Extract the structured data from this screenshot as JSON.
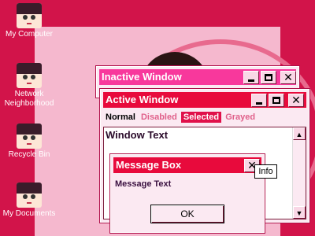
{
  "desktop_icons": [
    {
      "label": "My Computer"
    },
    {
      "label": "Network Neighborhood"
    },
    {
      "label": "Recycle Bin"
    },
    {
      "label": "My Documents"
    }
  ],
  "inactive_window": {
    "title": "Inactive Window",
    "titlebar_color": "#f8389c"
  },
  "active_window": {
    "title": "Active Window",
    "titlebar_color": "#e80a3c",
    "menu": {
      "normal": "Normal",
      "disabled": "Disabled",
      "selected": "Selected",
      "grayed": "Grayed"
    },
    "window_text": "Window Text",
    "scroll_up": "▲",
    "scroll_down": "▼"
  },
  "message_box": {
    "title": "Message Box",
    "message": "Message Text",
    "ok_label": "OK"
  },
  "tooltip": {
    "text": "Info"
  },
  "titlebar_buttons": {
    "close": "✕"
  },
  "colors": {
    "desktop": "#d2144a",
    "wallpaper": "#f5b8ce",
    "window_bg": "#fbe9f2"
  }
}
